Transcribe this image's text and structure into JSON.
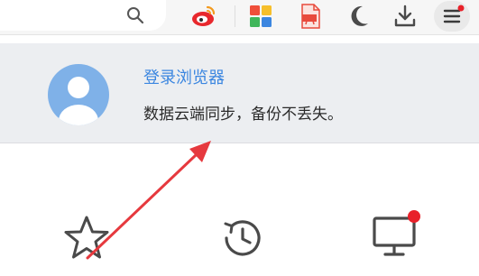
{
  "toolbar": {
    "icons": [
      "search-icon",
      "weibo-icon",
      "apps-grid-icon",
      "pdf-icon",
      "night-mode-icon",
      "download-icon",
      "menu-icon"
    ],
    "colors": {
      "weibo": "#e8282d",
      "pdf": "#e84a3c",
      "grid_red": "#ef4f3a",
      "grid_yellow": "#f6bf2b",
      "grid_green": "#3fb65a",
      "grid_blue": "#3b86e0",
      "notification_dot": "#e8212a"
    }
  },
  "login": {
    "title": "登录浏览器",
    "subtitle": "数据云端同步，备份不丢失。",
    "link_color": "#3b86e0"
  },
  "bottom": {
    "icons": [
      "star-icon",
      "history-icon",
      "monitor-icon"
    ]
  },
  "annotation": {
    "arrow_color": "#e6393e"
  }
}
